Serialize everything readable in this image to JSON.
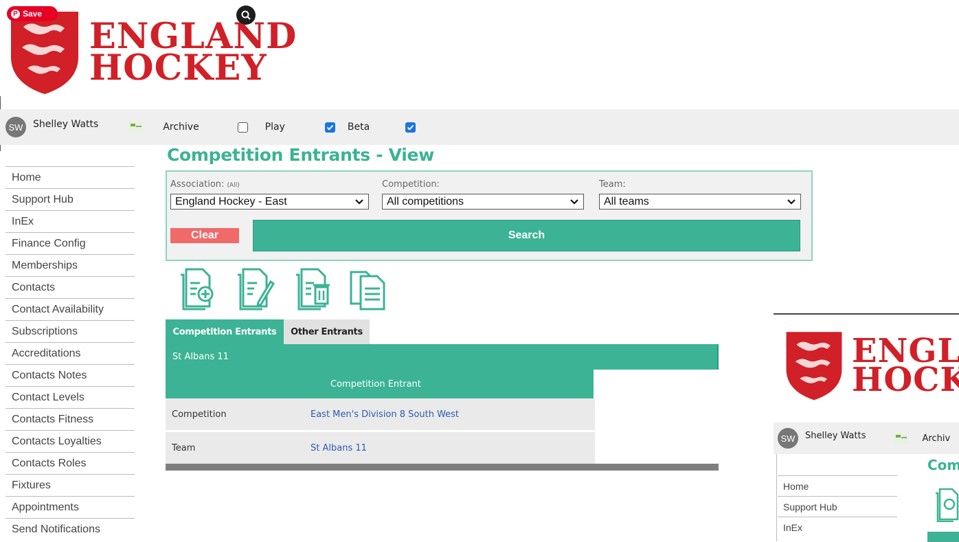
{
  "pinterest": {
    "save_label": "Save"
  },
  "brand": {
    "line1": "ENGLAND",
    "line2": "HOCKEY"
  },
  "user": {
    "initials": "SW",
    "name": "Shelley Watts"
  },
  "toggles": [
    {
      "label": "Archive",
      "checked": false
    },
    {
      "label": "Play",
      "checked": true
    },
    {
      "label": "Beta",
      "checked": true
    }
  ],
  "sidebar": {
    "items": [
      {
        "label": "Home"
      },
      {
        "label": "Support Hub"
      },
      {
        "label": "InEx"
      },
      {
        "label": "Finance Config"
      },
      {
        "label": "Memberships"
      },
      {
        "label": "Contacts"
      },
      {
        "label": "Contact Availability"
      },
      {
        "label": "Subscriptions"
      },
      {
        "label": "Accreditations"
      },
      {
        "label": "Contacts Notes"
      },
      {
        "label": "Contact Levels"
      },
      {
        "label": "Contacts Fitness"
      },
      {
        "label": "Contacts Loyalties"
      },
      {
        "label": "Contacts Roles"
      },
      {
        "label": "Fixtures"
      },
      {
        "label": "Appointments"
      },
      {
        "label": "Send Notifications"
      }
    ]
  },
  "page": {
    "title": "Competition Entrants - View"
  },
  "filters": {
    "association": {
      "label": "Association:",
      "hint": "(All)",
      "value": "England Hockey - East"
    },
    "competition": {
      "label": "Competition:",
      "value": "All competitions"
    },
    "team": {
      "label": "Team:",
      "value": "All teams"
    },
    "clear_label": "Clear",
    "search_label": "Search"
  },
  "toolbar_icons": [
    "document-add-icon",
    "document-edit-icon",
    "document-delete-icon",
    "document-copy-icon"
  ],
  "tabs": [
    {
      "label": "Competition Entrants",
      "active": true
    },
    {
      "label": "Other Entrants",
      "active": false
    }
  ],
  "record": {
    "title": "St Albans 11",
    "section_header": "Competition Entrant",
    "fields": [
      {
        "key": "Competition",
        "value": "East Men's Division 8 South West"
      },
      {
        "key": "Team",
        "value": "St Albans 11"
      }
    ]
  },
  "inset": {
    "brand": {
      "line1": "ENGLA",
      "line2": "HOCKE"
    },
    "user_initials": "SW",
    "user_name": "Shelley Watts",
    "toggle_label": "Archiv",
    "title": "Com",
    "nav": [
      {
        "label": "Home"
      },
      {
        "label": "Support Hub"
      },
      {
        "label": "InEx"
      }
    ]
  },
  "colors": {
    "accent": "#3bb394",
    "brand_red": "#d12027",
    "clear_red": "#f06a6a",
    "link_blue": "#2a5db0"
  }
}
